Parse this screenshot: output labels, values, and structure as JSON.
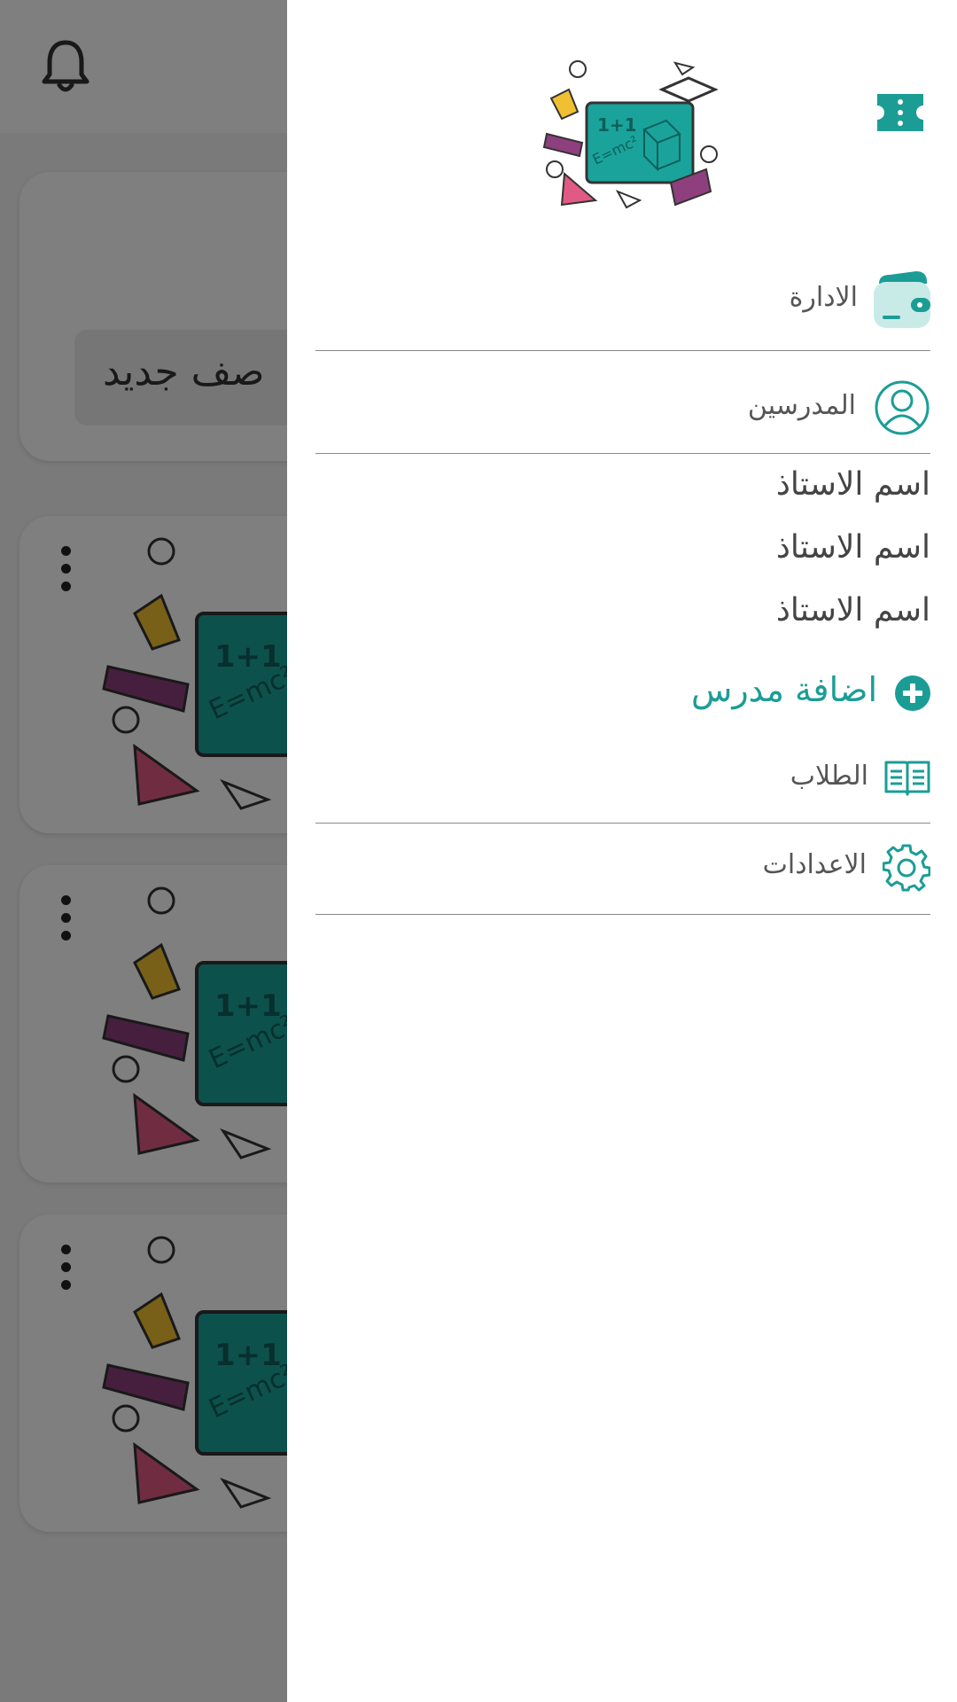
{
  "background": {
    "new_class_label": "صف جديد"
  },
  "drawer": {
    "menu": {
      "administration": "الادارة",
      "teachers": "المدرسين",
      "teacher_names": [
        "اسم الاستاذ",
        "اسم الاستاذ",
        "اسم الاستاذ"
      ],
      "add_teacher": "اضافة مدرس",
      "students": "الطلاب",
      "settings": "الاعدادات"
    }
  },
  "colors": {
    "accent": "#1b9d96",
    "board": "#1aa39b",
    "overlay": "rgba(0,0,0,0.5)"
  },
  "icons": {
    "bell": "notification-bell-icon",
    "kebab": "more-vert-icon",
    "close": "close-drawer-icon",
    "admin": "wallet-icon",
    "teachers": "user-circle-icon",
    "add": "plus-circle-icon",
    "students": "open-book-icon",
    "settings": "gear-icon"
  }
}
